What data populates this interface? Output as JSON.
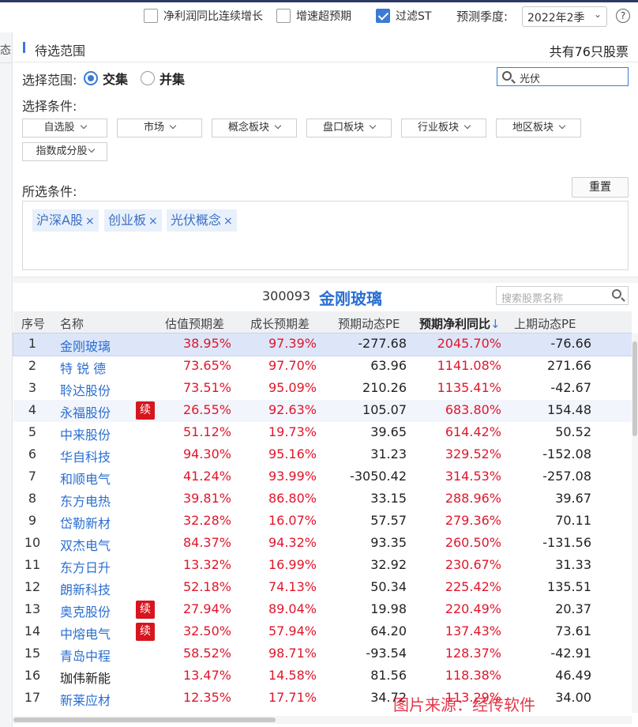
{
  "filters": {
    "net_profit_growth": {
      "label": "净利润同比连续增长",
      "checked": false
    },
    "growth_exceed": {
      "label": "增速超预期",
      "checked": false
    },
    "filter_st": {
      "label": "过滤ST",
      "checked": true
    },
    "quarter_label": "预测季度:",
    "quarter_value": "2022年2季",
    "help": "?"
  },
  "left_strip": {
    "tab_fragment": "态"
  },
  "panel": {
    "title": "待选范围",
    "count": "共有76只股票"
  },
  "range": {
    "label": "选择范围:",
    "options": [
      {
        "label": "交集",
        "selected": true
      },
      {
        "label": "并集",
        "selected": false
      }
    ],
    "search_value": "光伏"
  },
  "conditions": {
    "label": "选择条件:",
    "dropdowns": [
      "自选股",
      "市场",
      "概念板块",
      "盘口板块",
      "行业板块",
      "地区板块",
      "指数成分股"
    ]
  },
  "selected": {
    "label": "所选条件:",
    "reset": "重置",
    "chips": [
      "沪深A股",
      "创业板",
      "光伏概念"
    ],
    "remove_glyph": "×"
  },
  "stock": {
    "code": "300093",
    "name": "金刚玻璃",
    "search_placeholder": "搜索股票名称"
  },
  "table": {
    "headers": [
      "序号",
      "名称",
      "估值预期差",
      "成长预期差",
      "预期动态PE",
      "预期净利同比",
      "上期动态PE"
    ],
    "sort_arrow": "↓",
    "badge_text": "续",
    "rows": [
      {
        "no": "1",
        "name": "金刚玻璃",
        "badge": false,
        "v1": "38.95%",
        "v2": "97.39%",
        "v3": "-277.68",
        "v4": "2045.70%",
        "v5": "-76.66"
      },
      {
        "no": "2",
        "name": "特 锐 德",
        "badge": false,
        "v1": "73.65%",
        "v2": "97.70%",
        "v3": "63.96",
        "v4": "1141.08%",
        "v5": "271.66"
      },
      {
        "no": "3",
        "name": "聆达股份",
        "badge": false,
        "v1": "73.51%",
        "v2": "95.09%",
        "v3": "210.26",
        "v4": "1135.41%",
        "v5": "-42.67"
      },
      {
        "no": "4",
        "name": "永福股份",
        "badge": true,
        "v1": "26.55%",
        "v2": "92.63%",
        "v3": "105.07",
        "v4": "683.80%",
        "v5": "154.48"
      },
      {
        "no": "5",
        "name": "中来股份",
        "badge": false,
        "v1": "51.12%",
        "v2": "19.73%",
        "v3": "39.65",
        "v4": "614.42%",
        "v5": "50.52"
      },
      {
        "no": "6",
        "name": "华自科技",
        "badge": false,
        "v1": "94.30%",
        "v2": "95.16%",
        "v3": "31.23",
        "v4": "329.52%",
        "v5": "-152.08"
      },
      {
        "no": "7",
        "name": "和顺电气",
        "badge": false,
        "v1": "41.24%",
        "v2": "93.99%",
        "v3": "-3050.42",
        "v4": "314.53%",
        "v5": "-257.08"
      },
      {
        "no": "8",
        "name": "东方电热",
        "badge": false,
        "v1": "39.81%",
        "v2": "86.80%",
        "v3": "33.15",
        "v4": "288.96%",
        "v5": "39.67"
      },
      {
        "no": "9",
        "name": "岱勒新材",
        "badge": false,
        "v1": "32.28%",
        "v2": "16.07%",
        "v3": "57.57",
        "v4": "279.36%",
        "v5": "70.11"
      },
      {
        "no": "10",
        "name": "双杰电气",
        "badge": false,
        "v1": "84.37%",
        "v2": "94.32%",
        "v3": "93.35",
        "v4": "260.50%",
        "v5": "-131.56"
      },
      {
        "no": "11",
        "name": "东方日升",
        "badge": false,
        "v1": "13.32%",
        "v2": "16.99%",
        "v3": "32.92",
        "v4": "230.67%",
        "v5": "31.33"
      },
      {
        "no": "12",
        "name": "朗新科技",
        "badge": false,
        "v1": "52.18%",
        "v2": "74.13%",
        "v3": "50.34",
        "v4": "225.42%",
        "v5": "135.51"
      },
      {
        "no": "13",
        "name": "奥克股份",
        "badge": true,
        "v1": "27.94%",
        "v2": "89.04%",
        "v3": "19.98",
        "v4": "220.49%",
        "v5": "20.37"
      },
      {
        "no": "14",
        "name": "中熔电气",
        "badge": true,
        "v1": "32.50%",
        "v2": "57.94%",
        "v3": "64.20",
        "v4": "137.43%",
        "v5": "73.61"
      },
      {
        "no": "15",
        "name": "青岛中程",
        "badge": false,
        "v1": "58.52%",
        "v2": "98.71%",
        "v3": "-93.54",
        "v4": "128.37%",
        "v5": "-42.91"
      },
      {
        "no": "16",
        "name": "珈伟新能",
        "badge": false,
        "plain": true,
        "v1": "13.47%",
        "v2": "14.58%",
        "v3": "81.56",
        "v4": "118.38%",
        "v5": "46.49"
      },
      {
        "no": "17",
        "name": "新莱应材",
        "badge": false,
        "v1": "12.35%",
        "v2": "17.71%",
        "v3": "34.72",
        "v4": "113.29%",
        "v5": "34.00"
      }
    ]
  },
  "watermark": "图片来源：经传软件",
  "colors": {
    "accent": "#3a7bd5",
    "link": "#2b6fd1",
    "up": "#e0162b",
    "badge": "#d7151e"
  }
}
